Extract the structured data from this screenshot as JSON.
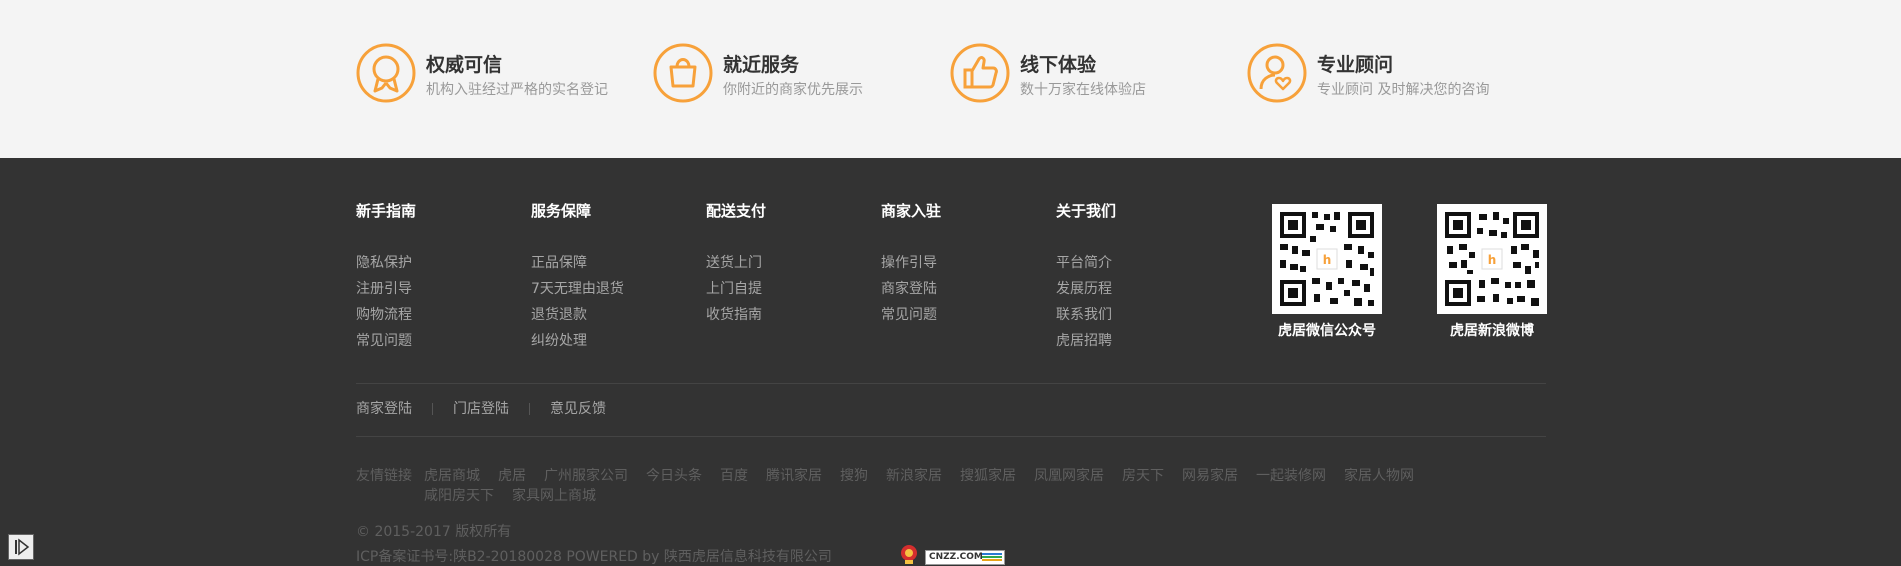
{
  "features": [
    {
      "icon": "badge-icon",
      "title": "权威可信",
      "desc": "机构入驻经过严格的实名登记"
    },
    {
      "icon": "shopping-bag-icon",
      "title": "就近服务",
      "desc": "你附近的商家优先展示"
    },
    {
      "icon": "thumbs-up-icon",
      "title": "线下体验",
      "desc": "数十万家在线体验店"
    },
    {
      "icon": "consultant-heart-icon",
      "title": "专业顾问",
      "desc": "专业顾问 及时解决您的咨询"
    }
  ],
  "columns": [
    {
      "heading": "新手指南",
      "links": [
        "隐私保护",
        "注册引导",
        "购物流程",
        "常见问题"
      ]
    },
    {
      "heading": "服务保障",
      "links": [
        "正品保障",
        "7天无理由退货",
        "退货退款",
        "纠纷处理"
      ]
    },
    {
      "heading": "配送支付",
      "links": [
        "送货上门",
        "上门自提",
        "收货指南"
      ]
    },
    {
      "heading": "商家入驻",
      "links": [
        "操作引导",
        "商家登陆",
        "常见问题"
      ]
    },
    {
      "heading": "关于我们",
      "links": [
        "平台简介",
        "发展历程",
        "联系我们",
        "虎居招聘"
      ]
    }
  ],
  "qrcodes": [
    {
      "label": "虎居微信公众号"
    },
    {
      "label": "虎居新浪微博"
    }
  ],
  "bottom_links": [
    "商家登陆",
    "门店登陆",
    "意见反馈"
  ],
  "friends": {
    "label": "友情链接",
    "line1": [
      "虎居商城",
      "虎居",
      "广州服家公司",
      "今日头条",
      "百度",
      "腾讯家居",
      "搜狗",
      "新浪家居",
      "搜狐家居",
      "凤凰网家居",
      "房天下",
      "网易家居",
      "一起装修网",
      "家居人物网"
    ],
    "line2": [
      "咸阳房天下",
      "家具网上商城"
    ]
  },
  "copyright": "© 2015-2017  版权所有",
  "icp": "ICP备案证书号:陕B2-20180028 POWERED by 陕西虎居信息科技有限公司",
  "cnzz_label": "CNZZ.COM",
  "colors": {
    "accent": "#f7a13a",
    "footer_bg": "#333333",
    "top_bg": "#f4f4f4"
  }
}
